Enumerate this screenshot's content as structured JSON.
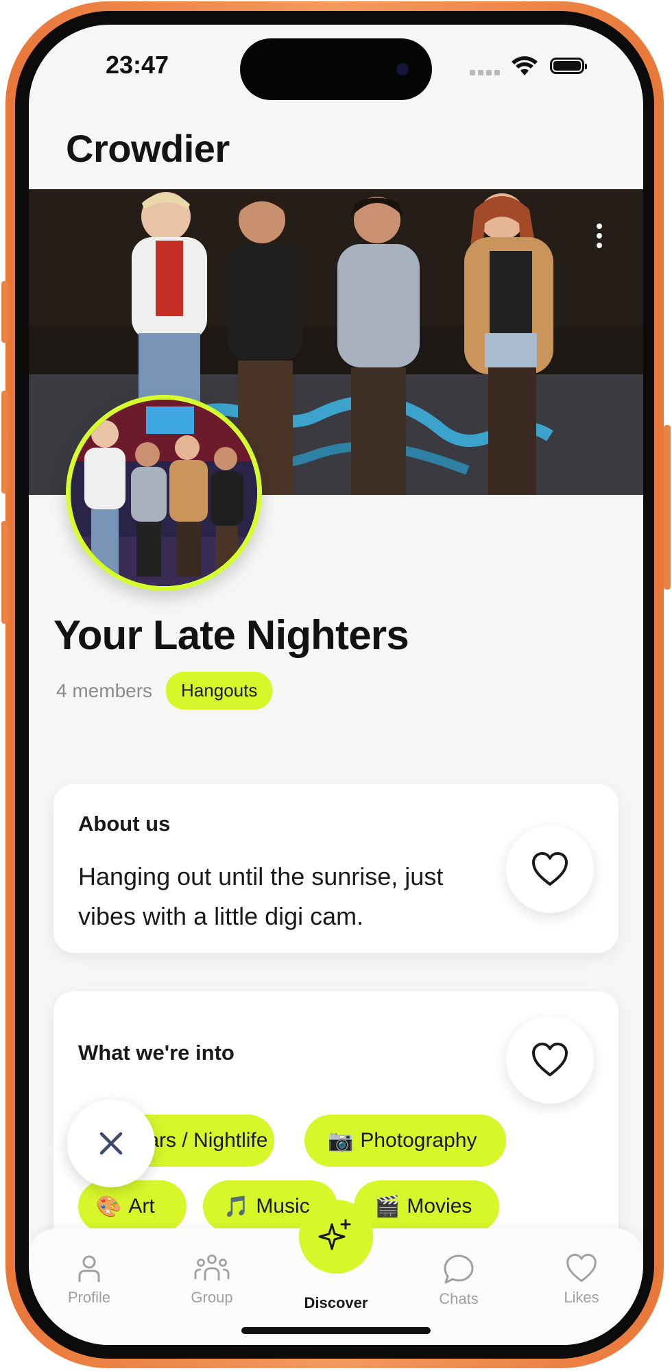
{
  "status_bar": {
    "time": "23:47"
  },
  "app": {
    "title": "Crowdier"
  },
  "group": {
    "name": "Your Late Nighters",
    "members": "4 members",
    "tag": "Hangouts"
  },
  "about": {
    "heading": "About us",
    "text": "Hanging out until the sunrise, just vibes with a little digi cam."
  },
  "interests": {
    "heading": "What we're into",
    "chips": [
      {
        "emoji": "🍸",
        "label": "Bars / Nightlife"
      },
      {
        "emoji": "📷",
        "label": "Photography"
      },
      {
        "emoji": "🎨",
        "label": "Art"
      },
      {
        "emoji": "🎵",
        "label": "Music"
      },
      {
        "emoji": "🎬",
        "label": "Movies"
      }
    ]
  },
  "tabs": [
    {
      "label": "Profile",
      "icon": "person-icon",
      "active": false
    },
    {
      "label": "Group",
      "icon": "group-icon",
      "active": false
    },
    {
      "label": "Discover",
      "icon": "sparkle-icon",
      "active": true
    },
    {
      "label": "Chats",
      "icon": "chat-bubble-icon",
      "active": false
    },
    {
      "label": "Likes",
      "icon": "heart-icon",
      "active": false
    }
  ],
  "colors": {
    "accent": "#d7f72a",
    "frame": "#e9773a",
    "background": "#f6f6f5"
  }
}
